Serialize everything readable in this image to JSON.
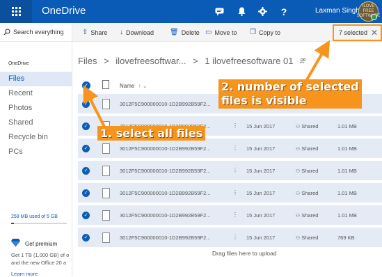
{
  "app": {
    "title": "OneDrive",
    "user_name": "Laxman Singh",
    "avatar_text": "ILOVE FREE SOFTWARE"
  },
  "topbar": {
    "icons": [
      "waffle-icon",
      "chat-icon",
      "bell-icon",
      "gear-icon",
      "help-icon"
    ],
    "help_label": "?"
  },
  "search": {
    "placeholder": "Search everything"
  },
  "nav": {
    "heading": "OneDrive",
    "items": [
      "Files",
      "Recent",
      "Photos",
      "Shared",
      "Recycle bin",
      "PCs"
    ],
    "active": "Files"
  },
  "quota": {
    "text": "258 MB used of 5 GB",
    "fraction_used": 0.05
  },
  "premium": {
    "title": "Get premium",
    "line1": "Get 1 TB (1,000 GB) of o",
    "line2": "and the new Office 20 a",
    "link": "Learn more"
  },
  "toolbar": {
    "share": "Share",
    "download": "Download",
    "delete": "Delete",
    "move_to": "Move to",
    "copy_to": "Copy to",
    "selected": "7 selected"
  },
  "breadcrumb": [
    "Files",
    ">",
    "ilovefreesoftwar...",
    ">",
    "1 ilovefreesoftware 01"
  ],
  "list": {
    "column_name": "Name",
    "sort_indicator": "↑ ⌄",
    "rows": [
      {
        "name": "3012F5C900000010-1D2B992B59F2...",
        "date": "",
        "sharing": "",
        "size": "1.01 MB"
      },
      {
        "name": "3012F5C900000010-1D2B992B59F2...",
        "date": "15 Jun 2017",
        "sharing": "Shared",
        "size": "1.01 MB"
      },
      {
        "name": "3012F5C900000010-1D2B992B59F2...",
        "date": "15 Jun 2017",
        "sharing": "Shared",
        "size": "1.01 MB"
      },
      {
        "name": "3012F5C900000010-1D2B992B59F2...",
        "date": "15 Jun 2017",
        "sharing": "Shared",
        "size": "1.01 MB"
      },
      {
        "name": "3012F5C900000010-1D2B992B59F2...",
        "date": "15 Jun 2017",
        "sharing": "Shared",
        "size": "1.01 MB"
      },
      {
        "name": "3012F5C900000010-1D2B992B59F2...",
        "date": "15 Jun 2017",
        "sharing": "Shared",
        "size": "1.01 MB"
      },
      {
        "name": "3012F5C900000010-1D2B992B59F2...",
        "date": "15 Jun 2017",
        "sharing": "Shared",
        "size": "769 KB"
      }
    ],
    "drag_hint": "Drag files here to upload"
  },
  "annotations": {
    "callout1": "1. select all files",
    "callout2_line1": "2. number of selected",
    "callout2_line2": "files is visible"
  },
  "colors": {
    "brand": "#0a5bb5",
    "accent": "#f7941d",
    "selected_row": "#e4ebf5"
  }
}
